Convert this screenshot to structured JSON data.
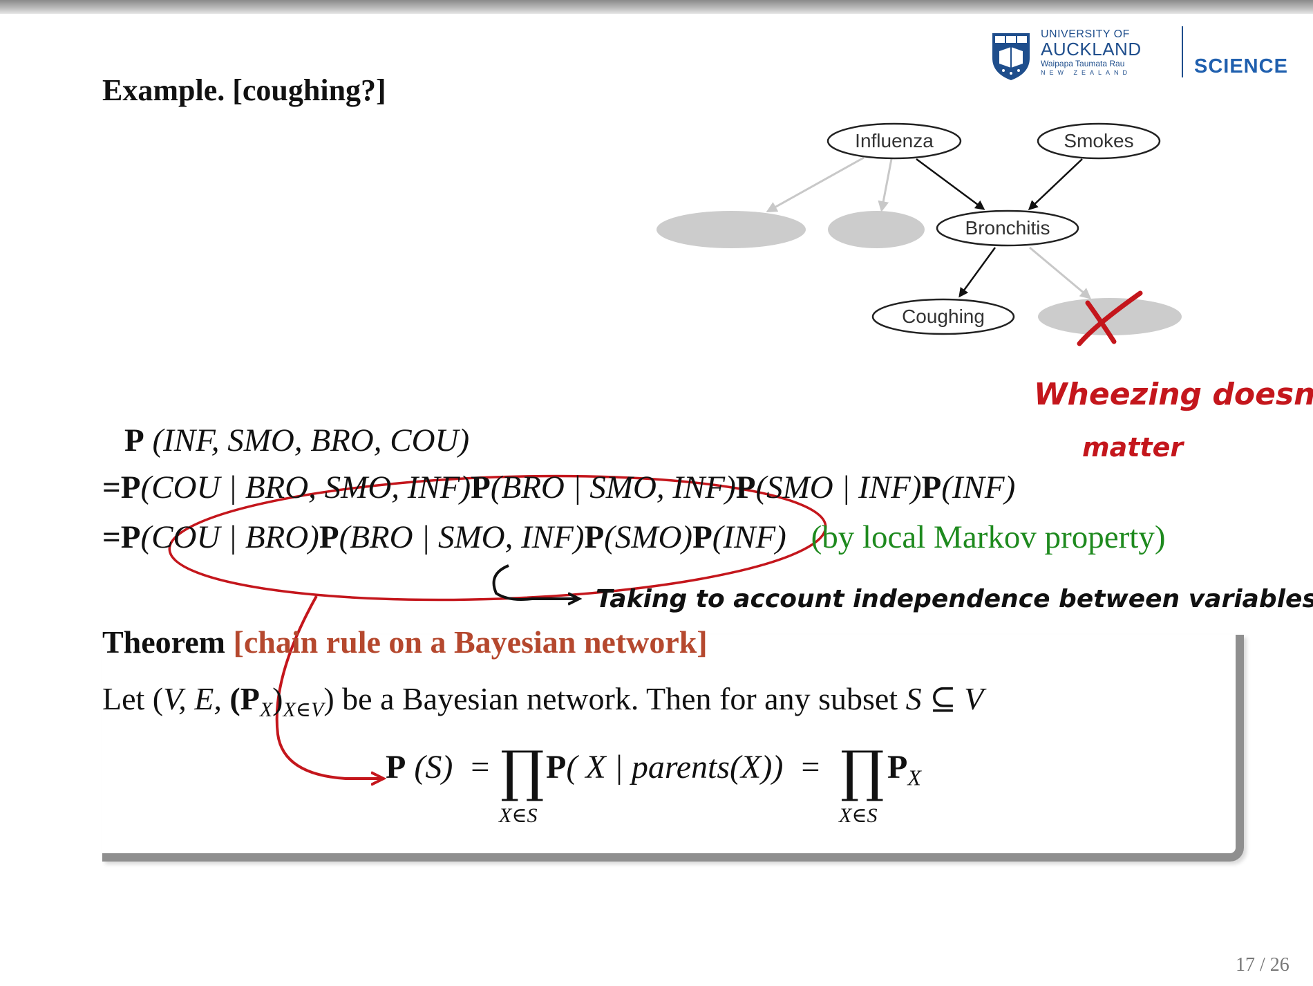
{
  "header": {
    "university_line1": "UNIVERSITY OF",
    "university_line2": "AUCKLAND",
    "university_line3": "Waipapa Taumata Rau",
    "university_line4": "NEW ZEALAND",
    "faculty": "SCIENCE"
  },
  "title": "Example. [coughing?]",
  "diagram": {
    "nodes": {
      "influenza": "Influenza",
      "smokes": "Smokes",
      "bronchitis": "Bronchitis",
      "coughing": "Coughing"
    }
  },
  "annotations": {
    "wheezing_line1": "Wheezing doesn't",
    "wheezing_line2": "matter",
    "independence": "Taking to account independence between variables",
    "cross_mark": "X"
  },
  "equations": {
    "line1": {
      "p": "P",
      "args": "(INF, SMO, BRO, COU)"
    },
    "line2": {
      "eq": "=",
      "p1": "P",
      "a1": "(COU | BRO, SMO, INF)",
      "p2": "P",
      "a2": "(BRO | SMO, INF)",
      "p3": "P",
      "a3": "(SMO | INF)",
      "p4": "P",
      "a4": "(INF)"
    },
    "line3": {
      "eq": "=",
      "p1": "P",
      "a1": "(COU | BRO)",
      "p2": "P",
      "a2": "(BRO | SMO, INF)",
      "p3": "P",
      "a3": "(SMO)",
      "p4": "P",
      "a4": "(INF)",
      "note": "(by local Markov property)"
    }
  },
  "theorem": {
    "label": "Theorem",
    "name": "[chain rule on a Bayesian network]",
    "statement_pre": "Let (",
    "statement_vars": "V, E,",
    "statement_p": "(P",
    "statement_sub1": "X",
    "statement_close": ")",
    "statement_sub2": "X∈V",
    "statement_post": ") be a Bayesian network. Then for any subset",
    "statement_set": "S ⊆ V",
    "formula": {
      "lhs_p": "P",
      "lhs_args": "(S)",
      "eq1": "=",
      "prod_symbol": "∏",
      "prod_sub": "X∈S",
      "mid_p": "P",
      "mid_args": "( X | parents(X))",
      "eq2": "=",
      "rhs_p": "P",
      "rhs_sub": "X"
    }
  },
  "page": "17 / 26",
  "colors": {
    "ink_red": "#c4161c",
    "markov_green": "#1e8a1e",
    "theorem_name": "#b5482e",
    "logo_blue": "#1f4e8c"
  }
}
